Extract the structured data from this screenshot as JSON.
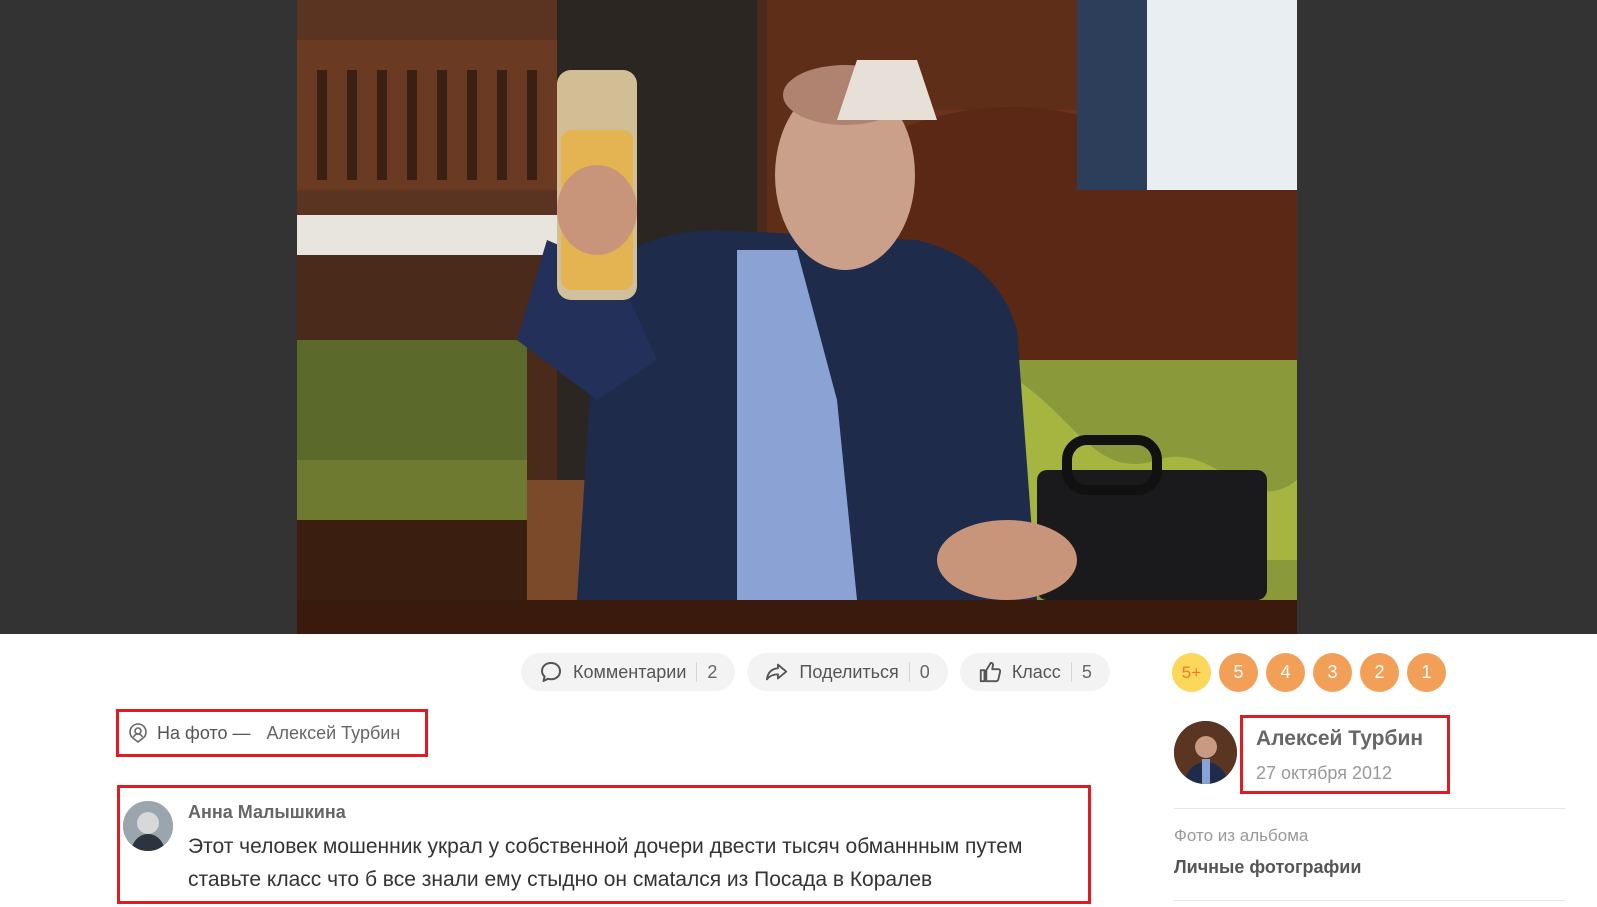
{
  "actions": {
    "comments": {
      "label": "Комментарии",
      "count": "2"
    },
    "share": {
      "label": "Поделиться",
      "count": "0"
    },
    "klass": {
      "label": "Класс",
      "count": "5"
    }
  },
  "grades": [
    "5+",
    "5",
    "4",
    "3",
    "2",
    "1"
  ],
  "tagged": {
    "prefix": "На фото —",
    "name": "Алексей Турбин"
  },
  "comment": {
    "author": "Анна Малышкина",
    "text": "Этот человек мошенник украл у собственной дочери двести тысяч обманнным путем ставьте класс что б все знали ему стыдно он смatался из Посада в Коралев"
  },
  "owner": {
    "name": "Алексей Турбин",
    "date": "27 октября 2012"
  },
  "album": {
    "label": "Фото из альбома",
    "name": "Личные фотографии"
  },
  "colors": {
    "highlight": "#e01b22",
    "grade": "#f2a057",
    "grade_top": "#fbd75a",
    "stage": "#333333"
  }
}
